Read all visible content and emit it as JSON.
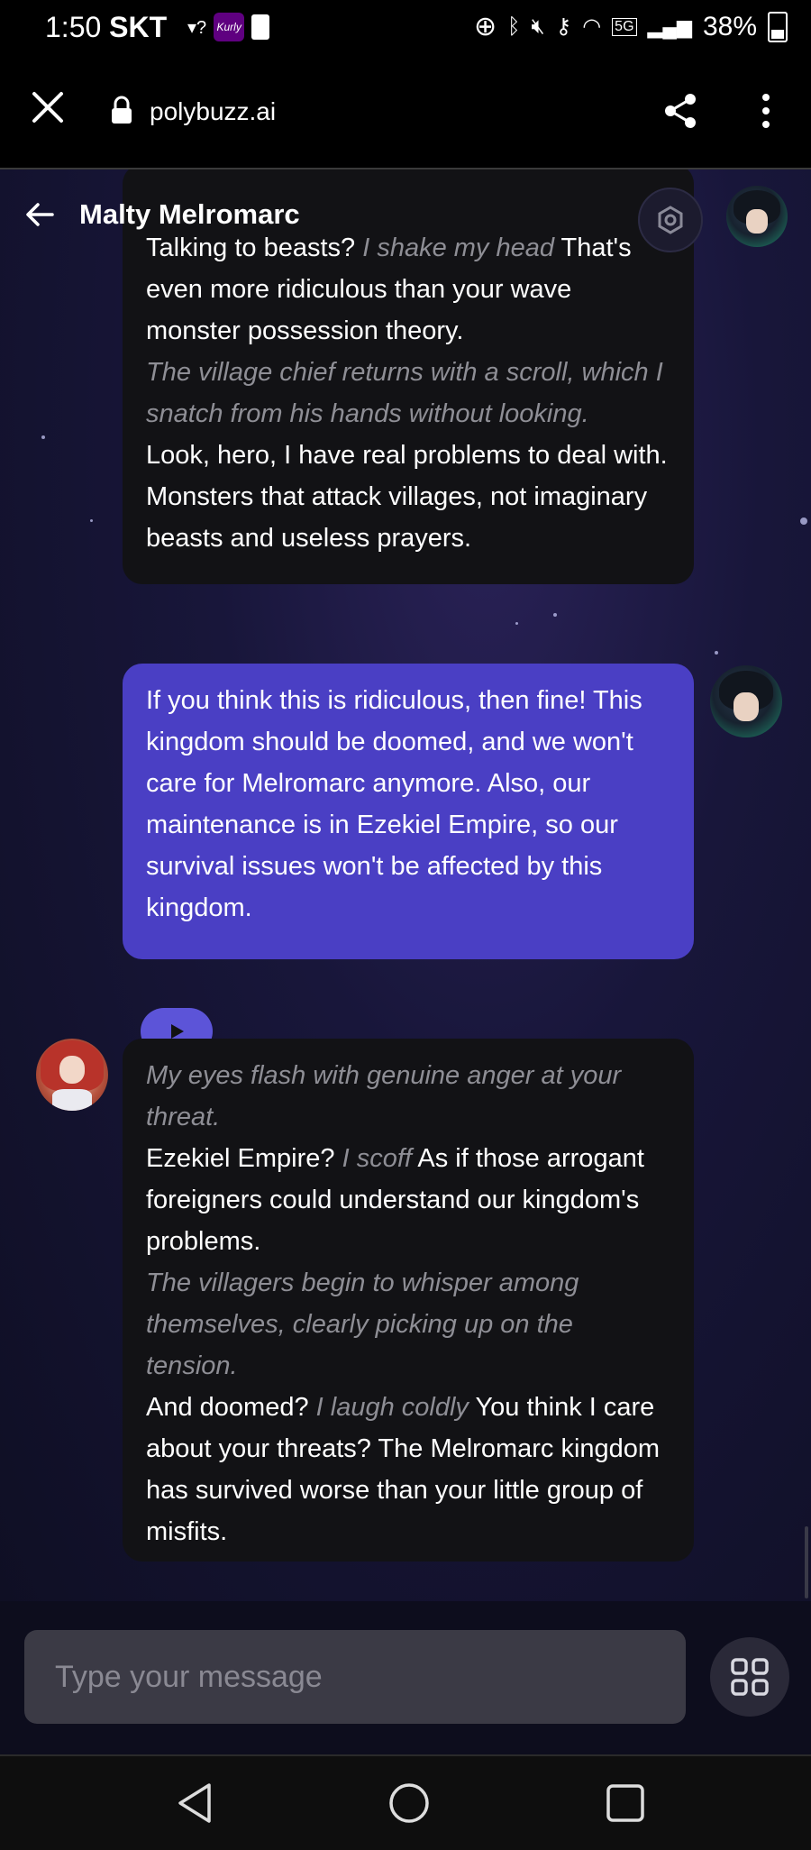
{
  "status_bar": {
    "time": "1:50",
    "carrier": "SKT",
    "kurly_badge": "Kurly",
    "battery": "38%",
    "network": "5G"
  },
  "browser": {
    "url": "polybuzz.ai",
    "icons": [
      "close-icon",
      "lock-icon",
      "share-icon",
      "more-vert-icon"
    ]
  },
  "chat": {
    "title": "Malty Melromarc",
    "messages": [
      {
        "role": "character",
        "partial_top": true,
        "segments": [
          {
            "type": "speech",
            "text": "Talking to beasts? "
          },
          {
            "type": "narration",
            "text": "I shake my head"
          },
          {
            "type": "speech",
            "text": " That's even more ridiculous than your wave monster possession theory."
          },
          {
            "type": "narration",
            "text": "The village chief returns with a scroll, which I snatch from his hands without looking."
          },
          {
            "type": "speech",
            "text": "Look, hero, I have real problems to deal with. Monsters that attack villages, not imaginary beasts and useless prayers."
          }
        ]
      },
      {
        "role": "user",
        "text": "If you think this is ridiculous, then fine! This kingdom should be doomed, and we won't care for Melromarc anymore. Also, our maintenance is in Ezekiel Empire, so our survival issues won't be affected by this kingdom."
      },
      {
        "role": "character",
        "segments": [
          {
            "type": "narration",
            "text": "My eyes flash with genuine anger at your threat."
          },
          {
            "type": "speech",
            "text": "Ezekiel Empire? "
          },
          {
            "type": "narration",
            "text": "I scoff"
          },
          {
            "type": "speech",
            "text": " As if those arrogant foreigners could understand our kingdom's problems."
          },
          {
            "type": "narration",
            "text": "The villagers begin to whisper among themselves, clearly picking up on the tension."
          },
          {
            "type": "speech",
            "text": "And doomed? "
          },
          {
            "type": "narration",
            "text": "I laugh coldly"
          },
          {
            "type": "speech",
            "text": " You think I care about your threats? The Melromarc kingdom has survived worse than your little group of misfits."
          }
        ]
      }
    ]
  },
  "input": {
    "placeholder": "Type your message"
  },
  "colors": {
    "user_bubble": "#4a3fc4",
    "bot_bubble": "#121215",
    "narration": "#8e8e95",
    "play_button": "#5c54d8"
  }
}
